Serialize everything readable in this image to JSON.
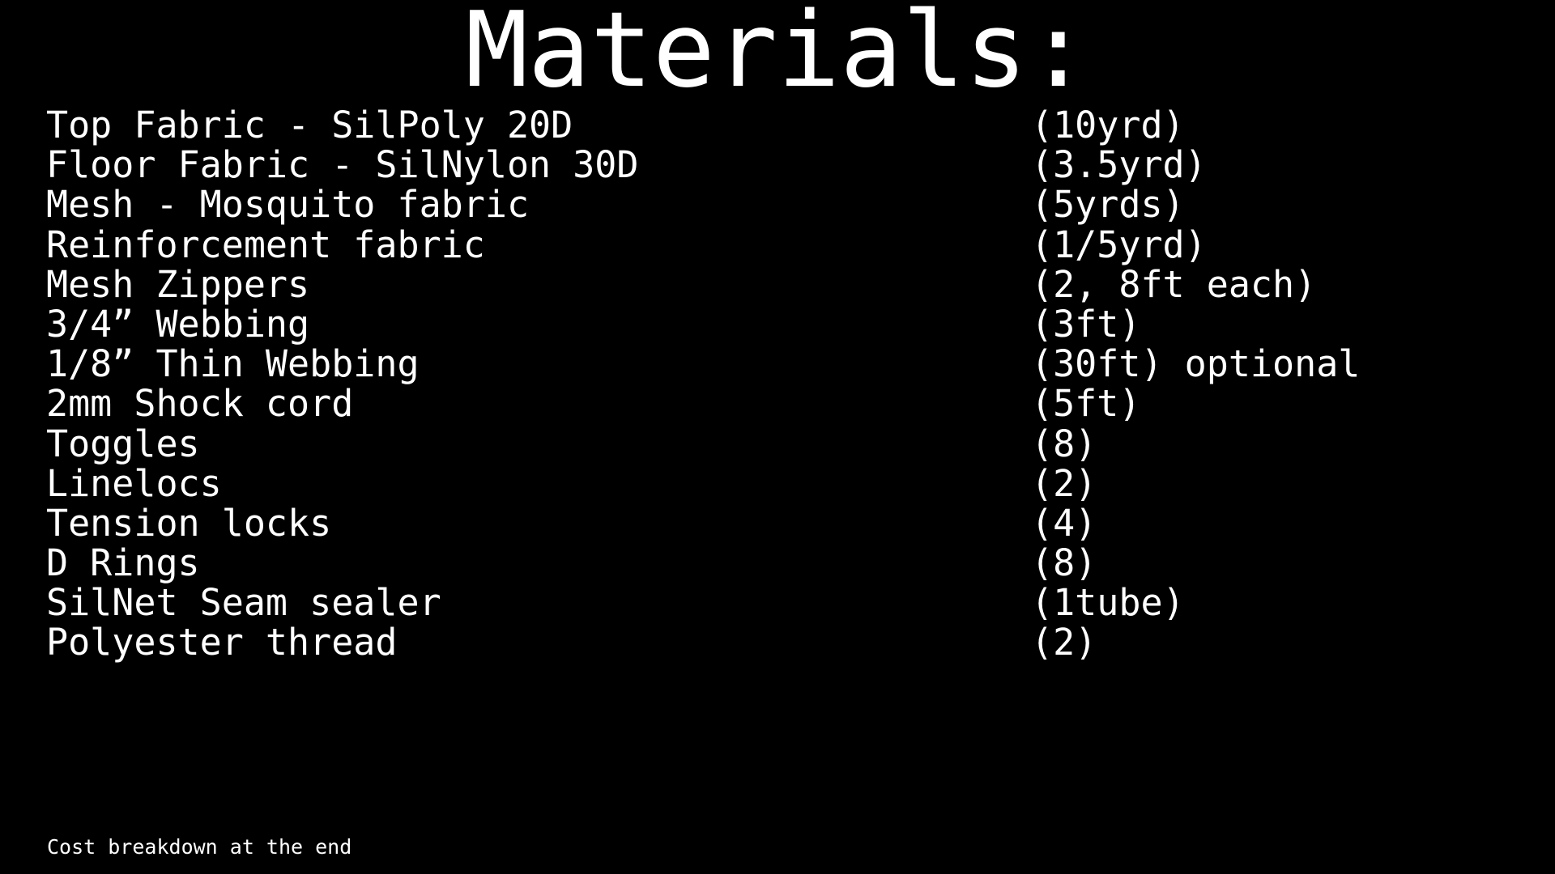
{
  "slide": {
    "title": "Materials:",
    "background_color": "#000000",
    "text_color": "#ffffff",
    "footnote": "Cost breakdown at the end"
  },
  "materials": [
    {
      "name": "Top Fabric - SilPoly 20D",
      "qty": "(10yrd)"
    },
    {
      "name": "Floor Fabric - SilNylon 30D",
      "qty": "(3.5yrd)"
    },
    {
      "name": "Mesh - Mosquito fabric",
      "qty": "(5yrds)"
    },
    {
      "name": "Reinforcement fabric",
      "qty": "(1/5yrd)"
    },
    {
      "name": "Mesh Zippers",
      "qty": "(2, 8ft each)"
    },
    {
      "name": "3/4” Webbing",
      "qty": "(3ft)"
    },
    {
      "name": "1/8” Thin Webbing",
      "qty": "(30ft) optional"
    },
    {
      "name": "2mm Shock cord",
      "qty": "(5ft)"
    },
    {
      "name": "Toggles",
      "qty": "(8)"
    },
    {
      "name": "Linelocs",
      "qty": "(2)"
    },
    {
      "name": "Tension locks",
      "qty": "(4)"
    },
    {
      "name": "D Rings",
      "qty": "(8)"
    },
    {
      "name": "SilNet Seam sealer",
      "qty": "(1tube)"
    },
    {
      "name": "Polyester thread",
      "qty": "(2)"
    }
  ]
}
